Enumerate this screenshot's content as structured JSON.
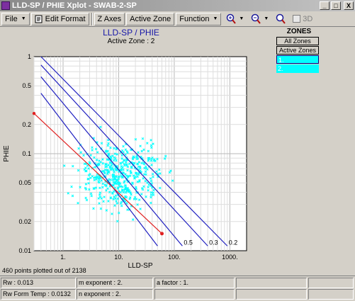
{
  "window": {
    "title": "LLD-SP / PHIE Xplot  -  SWAB-2-SP",
    "minimize_label": "_",
    "maximize_label": "□",
    "close_label": "X"
  },
  "menu": {
    "file": "File",
    "edit_format": "Edit Format",
    "z_axes": "Z Axes",
    "active_zone": "Active Zone",
    "function": "Function",
    "three_d": "3D"
  },
  "plot": {
    "title": "LLD-SP / PHIE",
    "subtitle": "Active Zone : 2"
  },
  "zones": {
    "label": "ZONES",
    "all_zones": "All Zones",
    "active_zones": "Active Zones",
    "rows": [
      "1.",
      "2."
    ]
  },
  "points_note": "460 points plotted out of 2138",
  "status": {
    "rw": "Rw : 0.013",
    "m_exponent": "m exponent : 2.",
    "a_factor": "a factor : 1.",
    "rw_form_temp": "Rw Form Temp : 0.0132",
    "n_exponent": "n exponent : 2."
  },
  "colors": {
    "grid_bg": "#ffffff",
    "points": "#00ffff",
    "sw_lines": "#2020c0",
    "rw_line": "#e02020",
    "title": "#1616a8"
  },
  "chart_data": {
    "type": "scatter",
    "title": "LLD-SP / PHIE",
    "subtitle": "Active Zone : 2",
    "xlabel": "LLD-SP",
    "ylabel": "PHIE",
    "x_scale": "log",
    "y_scale": "log",
    "xlim": [
      0.3,
      2000
    ],
    "ylim": [
      0.01,
      1
    ],
    "x_ticks": [
      {
        "value": 1,
        "label": "1."
      },
      {
        "value": 10,
        "label": "10."
      },
      {
        "value": 100,
        "label": "100."
      },
      {
        "value": 1000,
        "label": "1000."
      }
    ],
    "y_ticks": [
      {
        "value": 1,
        "label": "1"
      },
      {
        "value": 0.5,
        "label": "0.5"
      },
      {
        "value": 0.2,
        "label": "0.2"
      },
      {
        "value": 0.1,
        "label": "0.1"
      },
      {
        "value": 0.05,
        "label": "0.05"
      },
      {
        "value": 0.02,
        "label": "0.02"
      },
      {
        "value": 0.01,
        "label": "0.01"
      }
    ],
    "grid": true,
    "lines": [
      {
        "label": "0.5",
        "color": "#2020c0",
        "points": [
          [
            0.4,
            0.62
          ],
          [
            140,
            0.0112
          ]
        ]
      },
      {
        "label": "0.3",
        "color": "#2020c0",
        "points": [
          [
            0.4,
            0.82
          ],
          [
            400,
            0.0112
          ]
        ]
      },
      {
        "label": "0.2",
        "color": "#2020c0",
        "points": [
          [
            0.4,
            1.0
          ],
          [
            900,
            0.0112
          ]
        ]
      },
      {
        "label": "",
        "color": "#2020c0",
        "points": [
          [
            0.4,
            0.42
          ],
          [
            50,
            0.0112
          ]
        ]
      },
      {
        "label": "",
        "color": "#e02020",
        "points": [
          [
            0.3,
            0.26
          ],
          [
            60,
            0.015
          ]
        ]
      }
    ],
    "scatter_clusters": [
      {
        "name": "zone 2",
        "color": "#00ffff",
        "center_x": 12,
        "center_y": 0.06,
        "count": 460
      }
    ]
  }
}
